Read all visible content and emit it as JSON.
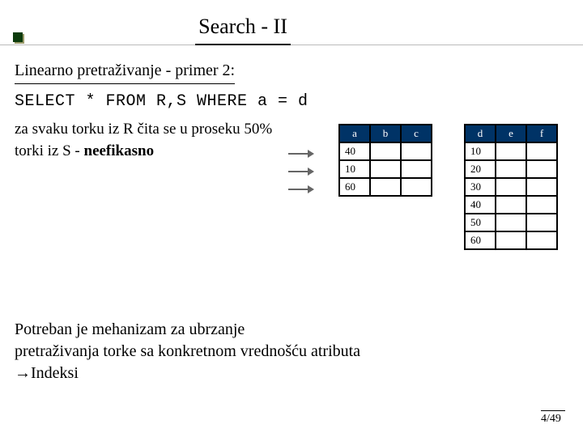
{
  "title": "Search - II",
  "subhead": "Linearno pretraživanje - primer 2:",
  "sql": "SELECT * FROM R,S WHERE a = d",
  "body_l1": "za svaku torku iz R čita se u proseku 50%",
  "body_l2a": "torki iz S - ",
  "body_l2b": "neefikasno",
  "tableR": {
    "headers": [
      "a",
      "b",
      "c"
    ],
    "rows": [
      [
        "40",
        "",
        ""
      ],
      [
        "10",
        "",
        ""
      ],
      [
        "60",
        "",
        ""
      ]
    ]
  },
  "tableS": {
    "headers": [
      "d",
      "e",
      "f"
    ],
    "rows": [
      [
        "10",
        "",
        ""
      ],
      [
        "20",
        "",
        ""
      ],
      [
        "30",
        "",
        ""
      ],
      [
        "40",
        "",
        ""
      ],
      [
        "50",
        "",
        ""
      ],
      [
        "60",
        "",
        ""
      ]
    ]
  },
  "conclusion_l1": "Potreban je mehanizam za ubrzanje",
  "conclusion_l2": "pretraživanja torke sa konkretnom vrednošću atributa",
  "conclusion_l3": "→Indeksi",
  "page": "4/49"
}
